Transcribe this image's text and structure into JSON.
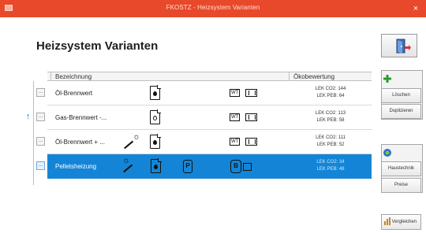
{
  "window": {
    "title": "FKOSTZ - Heizsystem Varianten",
    "close_glyph": "×"
  },
  "page": {
    "heading": "Heizsystem Varianten"
  },
  "table": {
    "columns": [
      "Bezeichnung",
      "Ökobewertung"
    ],
    "rows": [
      {
        "name": "Öl-Brennwert",
        "lek_co2": "LEK CO2: 144",
        "lek_peb": "LEK PEB: 64",
        "selected": false
      },
      {
        "name": "Gas-Brennwert -...",
        "lek_co2": "LEK CO2: 113",
        "lek_peb": "LEK PEB: 58",
        "selected": false
      },
      {
        "name": "Öl-Brennwert + ...",
        "lek_co2": "LEK CO2: 111",
        "lek_peb": "LEK PEB: 52",
        "selected": false
      },
      {
        "name": "Pelletsheizung",
        "lek_co2": "LEK CO2: 34",
        "lek_peb": "LEK PEB: 48",
        "selected": true
      }
    ],
    "row_button_label": "...",
    "wt_label": "WT",
    "p_label": "P",
    "b_label": "B"
  },
  "sidebar": {
    "loeschen": "Löschen",
    "duplizieren": "Duplizieren",
    "haustechnik": "Haustechnik",
    "preise": "Preise",
    "vergleichen": "Vergleichen"
  },
  "colors": {
    "titlebar": "#e8492a",
    "selection": "#1485d6"
  }
}
